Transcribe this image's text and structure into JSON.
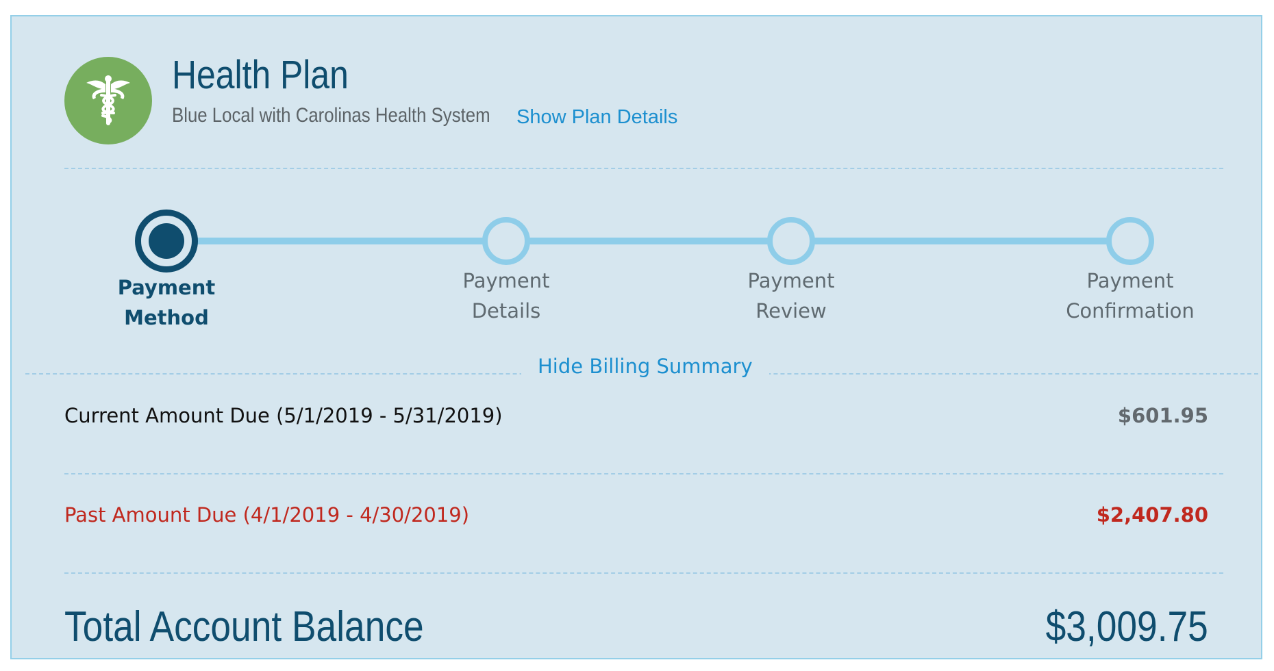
{
  "plan": {
    "title": "Health Plan",
    "subtitle": "Blue Local with Carolinas Health System",
    "details_link": "Show Plan Details",
    "icon": "caduceus-icon"
  },
  "steps": [
    {
      "line1": "Payment",
      "line2": "Method",
      "active": true
    },
    {
      "line1": "Payment",
      "line2": "Details",
      "active": false
    },
    {
      "line1": "Payment",
      "line2": "Review",
      "active": false
    },
    {
      "line1": "Payment",
      "line2": "Confirmation",
      "active": false
    }
  ],
  "billing": {
    "toggle_label": "Hide Billing Summary",
    "current": {
      "label": "Current Amount Due (5/1/2019 - 5/31/2019)",
      "amount": "$601.95"
    },
    "past": {
      "label": "Past Amount Due (4/1/2019 - 4/30/2019)",
      "amount": "$2,407.80"
    },
    "total": {
      "label": "Total Account Balance",
      "amount": "$3,009.75"
    }
  },
  "colors": {
    "card_background": "#d6e6ef",
    "card_border": "#94cfe8",
    "brand_dark": "#0f4d6e",
    "link_blue": "#1c8fcf",
    "step_inactive": "#8ecde9",
    "icon_green": "#77ae5e",
    "past_due_red": "#c0281e",
    "current_amount_gray": "#62696e"
  }
}
